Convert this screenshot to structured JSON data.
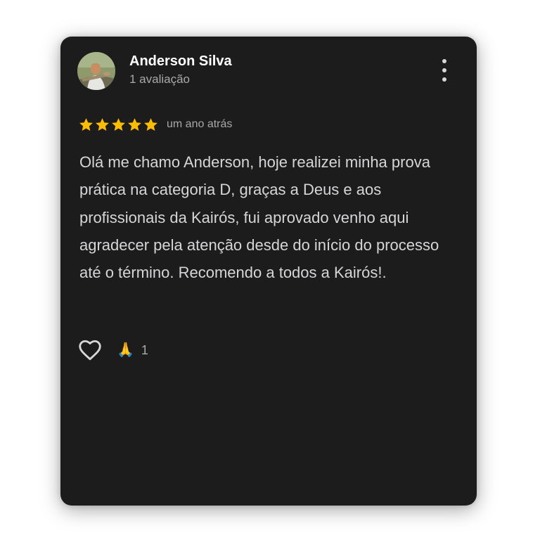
{
  "review": {
    "author_name": "Anderson Silva",
    "author_reviews": "1 avaliação",
    "rating": 5,
    "rating_max": 5,
    "time_ago": "um ano atrás",
    "text": "Olá me chamo Anderson, hoje realizei minha prova prática na categoria D, graças a Deus e aos profissionais da Kairós, fui aprovado venho aqui agradecer pela atenção desde do início do processo até o término. Recomendo a todos a Kairós!.",
    "reaction_emoji": "🙏",
    "reaction_count": "1"
  },
  "icons": {
    "menu": "more-vertical-icon",
    "like": "heart-outline-icon",
    "star": "star-icon",
    "reaction": "folded-hands-icon"
  },
  "colors": {
    "card_background": "#1c1c1d",
    "star": "#fbbc04",
    "primary_text": "#ffffff",
    "secondary_text": "#a9a9ab",
    "body_text": "#d6d6d8"
  }
}
